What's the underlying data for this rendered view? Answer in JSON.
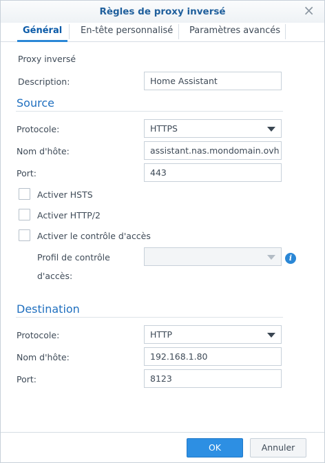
{
  "dialog": {
    "title": "Règles de proxy inversé",
    "close_icon": "close-icon"
  },
  "tabs": [
    {
      "label": "Général",
      "active": true
    },
    {
      "label": "En-tête personnalisé",
      "active": false
    },
    {
      "label": "Paramètres avancés",
      "active": false
    }
  ],
  "general": {
    "heading": "Proxy inversé",
    "description_label": "Description:",
    "description_value": "Home Assistant"
  },
  "source": {
    "heading": "Source",
    "protocol_label": "Protocole:",
    "protocol_value": "HTTPS",
    "hostname_label": "Nom d'hôte:",
    "hostname_value": "assistant.nas.mondomain.ovh",
    "port_label": "Port:",
    "port_value": "443",
    "hsts_label": "Activer HSTS",
    "hsts_checked": false,
    "http2_label": "Activer HTTP/2",
    "http2_checked": false,
    "access_label": "Activer le contrôle d'accès",
    "access_checked": false,
    "profile_label_line1": "Profil de contrôle",
    "profile_label_line2": "d'accès:",
    "profile_value": ""
  },
  "destination": {
    "heading": "Destination",
    "protocol_label": "Protocole:",
    "protocol_value": "HTTP",
    "hostname_label": "Nom d'hôte:",
    "hostname_value": "192.168.1.80",
    "port_label": "Port:",
    "port_value": "8123"
  },
  "footer": {
    "ok_label": "OK",
    "cancel_label": "Annuler"
  },
  "colors": {
    "accent": "#2d8fe3",
    "section_heading": "#1f6fbf",
    "title": "#1f5f9c"
  }
}
